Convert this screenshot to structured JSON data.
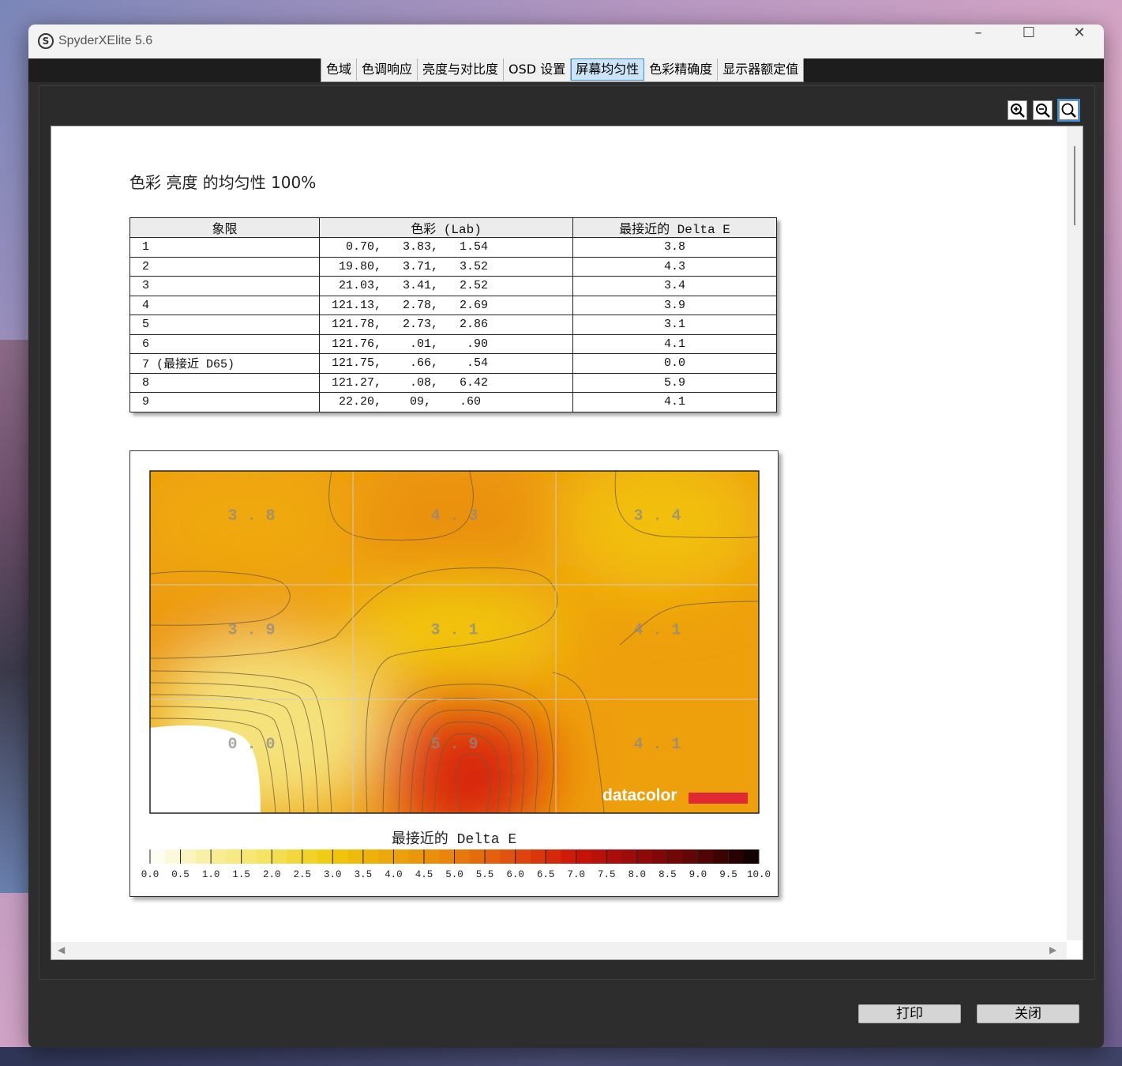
{
  "window": {
    "title": "SpyderXElite 5.6",
    "icon": "spyder-app-icon"
  },
  "window_controls": [
    "minimize-icon",
    "maximize-icon",
    "close-icon"
  ],
  "tabs": [
    "色域",
    "色调响应",
    "亮度与对比度",
    "OSD 设置",
    "屏幕均匀性",
    "色彩精确度",
    "显示器额定值"
  ],
  "active_tab": "屏幕均匀性",
  "zoom_tools": [
    "zoom-in-icon",
    "zoom-out-icon",
    "zoom-fit-icon"
  ],
  "report": {
    "title": "色彩 亮度 的均匀性 100%",
    "table": {
      "headers": [
        "象限",
        "色彩 (Lab)",
        "最接近的 Delta E"
      ],
      "rows": [
        {
          "quadrant": "1",
          "lab": "  0.70,   3.83,   1.54",
          "delta_e": "3.8"
        },
        {
          "quadrant": "2",
          "lab": " 19.80,   3.71,   3.52",
          "delta_e": "4.3"
        },
        {
          "quadrant": "3",
          "lab": " 21.03,   3.41,   2.52",
          "delta_e": "3.4"
        },
        {
          "quadrant": "4",
          "lab": "121.13,   2.78,   2.69",
          "delta_e": "3.9"
        },
        {
          "quadrant": "5",
          "lab": "121.78,   2.73,   2.86",
          "delta_e": "3.1"
        },
        {
          "quadrant": "6",
          "lab": "121.76,    .01,    .90",
          "delta_e": "4.1"
        },
        {
          "quadrant": "7 (最接近 D65)",
          "lab": "121.75,    .66,    .54",
          "delta_e": "0.0"
        },
        {
          "quadrant": "8",
          "lab": "121.27,    .08,   6.42",
          "delta_e": "5.9"
        },
        {
          "quadrant": "9",
          "lab": " 22.20,    09,    .60",
          "delta_e": "4.1"
        }
      ]
    },
    "heatmap": {
      "cell_labels": [
        "3.8",
        "4.3",
        "3.4",
        "3.9",
        "3.1",
        "4.1",
        "0.0",
        "5.9",
        "4.1"
      ],
      "logo": "datacolor",
      "brand_red": "#e02a33",
      "legend_title": "最接近的 Delta E",
      "legend_ticks": [
        "0.0",
        "0.5",
        "1.0",
        "1.5",
        "2.0",
        "2.5",
        "3.0",
        "3.5",
        "4.0",
        "4.5",
        "5.0",
        "5.5",
        "6.0",
        "6.5",
        "7.0",
        "7.5",
        "8.0",
        "8.5",
        "9.0",
        "9.5",
        "10.0"
      ]
    }
  },
  "chart_data": {
    "type": "heatmap",
    "title": "",
    "rows": 3,
    "cols": 3,
    "values": [
      [
        3.8,
        4.3,
        3.4
      ],
      [
        3.9,
        3.1,
        4.1
      ],
      [
        0.0,
        5.9,
        4.1
      ]
    ],
    "colorbar_label": "最接近的 Delta E",
    "colorbar_range": [
      0.0,
      10.0
    ],
    "colorbar_ticks": [
      "0.0",
      "0.5",
      "1.0",
      "1.5",
      "2.0",
      "2.5",
      "3.0",
      "3.5",
      "4.0",
      "4.5",
      "5.0",
      "5.5",
      "6.0",
      "6.5",
      "7.0",
      "7.5",
      "8.0",
      "8.5",
      "9.0",
      "9.5",
      "10.0"
    ]
  },
  "buttons": {
    "print": "打印",
    "close": "关闭"
  }
}
